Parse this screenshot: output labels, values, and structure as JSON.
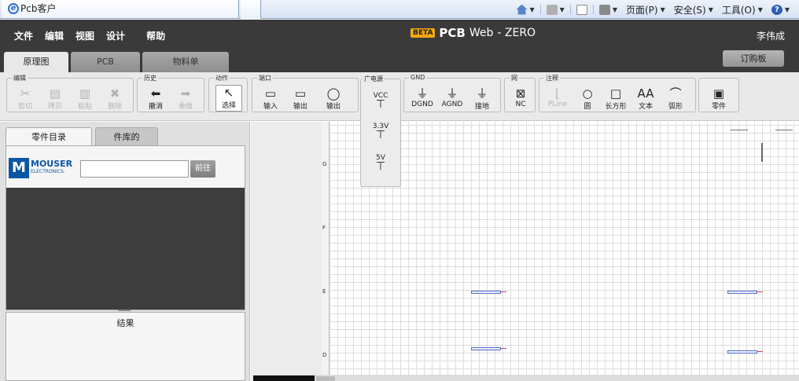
{
  "browser": {
    "tab_title": "Pcb客户",
    "toolbar_items": [
      {
        "label": "",
        "icon": "home-icon"
      },
      {
        "label": "",
        "icon": "rss-icon"
      },
      {
        "label": "",
        "icon": "mail-icon"
      },
      {
        "label": "",
        "icon": "print-icon"
      },
      {
        "label": "页面(P)",
        "icon": ""
      },
      {
        "label": "安全(S)",
        "icon": ""
      },
      {
        "label": "工具(O)",
        "icon": ""
      },
      {
        "label": "",
        "icon": "help-icon"
      }
    ]
  },
  "app": {
    "menu": [
      "文件",
      "编辑",
      "视图",
      "设计",
      "帮助"
    ],
    "brand": {
      "beta": "BETA",
      "pcb": "PCB",
      "web": "Web",
      "suffix": "- ZERO"
    },
    "user": "李伟成",
    "tabs": [
      "原理图",
      "PCB",
      "物料单"
    ],
    "order_button": "订购板"
  },
  "toolbar": {
    "groups": [
      {
        "title": "编辑",
        "buttons": [
          {
            "label": "剪切",
            "glyph": "✂",
            "disabled": true
          },
          {
            "label": "拷贝",
            "glyph": "▤",
            "disabled": true
          },
          {
            "label": "粘贴",
            "glyph": "▥",
            "disabled": true
          },
          {
            "label": "删除",
            "glyph": "✖",
            "disabled": true
          }
        ]
      },
      {
        "title": "历史",
        "buttons": [
          {
            "label": "撤消",
            "glyph": "⬅",
            "disabled": false
          },
          {
            "label": "重做",
            "glyph": "➡",
            "disabled": true
          }
        ]
      },
      {
        "title": "动作",
        "buttons": [
          {
            "label": "选择",
            "glyph": "↖",
            "disabled": false
          }
        ]
      },
      {
        "title": "端口",
        "buttons": [
          {
            "label": "输入",
            "glyph": "▭",
            "disabled": false
          },
          {
            "label": "输出",
            "glyph": "▭",
            "disabled": false
          },
          {
            "label": "输出",
            "glyph": "◯",
            "disabled": false
          }
        ]
      },
      {
        "title": "GND",
        "buttons": [
          {
            "label": "DGND",
            "glyph": "⏚",
            "disabled": false
          },
          {
            "label": "AGND",
            "glyph": "⏚",
            "disabled": false
          },
          {
            "label": "接地",
            "glyph": "⏚",
            "disabled": false
          }
        ]
      },
      {
        "title": "网",
        "buttons": [
          {
            "label": "NC",
            "glyph": "⊠",
            "disabled": false
          }
        ]
      },
      {
        "title": "注释",
        "buttons": [
          {
            "label": "PLine",
            "glyph": "⌊",
            "disabled": true
          },
          {
            "label": "圆",
            "glyph": "○",
            "disabled": false
          },
          {
            "label": "长方形",
            "glyph": "□",
            "disabled": false
          },
          {
            "label": "文本",
            "glyph": "AA",
            "disabled": false
          },
          {
            "label": "弧形",
            "glyph": "⌒",
            "disabled": false
          }
        ]
      },
      {
        "title": "",
        "buttons": [
          {
            "label": "零件",
            "glyph": "▣",
            "disabled": false
          }
        ]
      }
    ],
    "power": {
      "title": "广电源",
      "items": [
        "VCC",
        "3.3V",
        "5V"
      ]
    }
  },
  "left_panel": {
    "tabs": [
      "零件目录",
      "件库的"
    ],
    "brand_name": "MOUSER",
    "brand_sub": "ELECTRONICS.",
    "search_value": "",
    "go_button": "前往",
    "results_title": "结果"
  },
  "canvas": {
    "ruler_labels": [
      "G",
      "F",
      "E",
      "D"
    ]
  }
}
